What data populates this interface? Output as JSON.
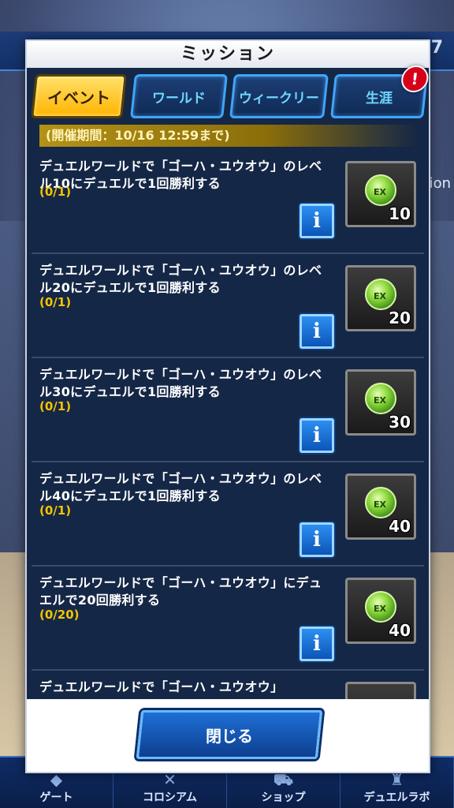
{
  "background": {
    "top_number": "7",
    "side_text": "ion",
    "nav": [
      {
        "label": "ゲート",
        "icon": "gate-icon",
        "glyph": "◆"
      },
      {
        "label": "コロシアム",
        "icon": "colosseum-icon",
        "glyph": "✕"
      },
      {
        "label": "ショップ",
        "icon": "shop-cart-icon",
        "glyph": "⛟"
      },
      {
        "label": "デュエルラボ",
        "icon": "duel-lab-icon",
        "glyph": "♜"
      }
    ]
  },
  "modal": {
    "title": "ミッション",
    "tabs": [
      {
        "label": "イベント",
        "active": true
      },
      {
        "label": "ワールド",
        "active": false
      },
      {
        "label": "ウィークリー",
        "active": false
      },
      {
        "label": "生涯",
        "active": false,
        "badge": "!"
      }
    ],
    "period": "(開催期間：10/16 12:59まで)",
    "missions": [
      {
        "title": "デュエルワールドで「ゴーハ・ユウオウ」のレベル10にデュエルで1回勝利する",
        "progress": "(0/1)",
        "reward_qty": "10",
        "info": "i",
        "reward_label": "EX"
      },
      {
        "title": "デュエルワールドで「ゴーハ・ユウオウ」のレベル20にデュエルで1回勝利する",
        "progress": "(0/1)",
        "reward_qty": "20",
        "info": "i",
        "reward_label": "EX"
      },
      {
        "title": "デュエルワールドで「ゴーハ・ユウオウ」のレベル30にデュエルで1回勝利する",
        "progress": "(0/1)",
        "reward_qty": "30",
        "info": "i",
        "reward_label": "EX"
      },
      {
        "title": "デュエルワールドで「ゴーハ・ユウオウ」のレベル40にデュエルで1回勝利する",
        "progress": "(0/1)",
        "reward_qty": "40",
        "info": "i",
        "reward_label": "EX"
      },
      {
        "title": "デュエルワールドで「ゴーハ・ユウオウ」にデュエルで20回勝利する",
        "progress": "(0/20)",
        "reward_qty": "40",
        "info": "i",
        "reward_label": "EX"
      },
      {
        "title": "デュエルワールドで「ゴーハ・ユウオウ」",
        "progress": "",
        "reward_qty": "",
        "info": "",
        "reward_label": ""
      }
    ],
    "close_label": "閉じる"
  },
  "colors": {
    "active_tab": "#ffc21a",
    "tab_border": "#3ea6ff",
    "progress": "#f5c400",
    "panel": "#152746",
    "alert": "#d6001a"
  }
}
